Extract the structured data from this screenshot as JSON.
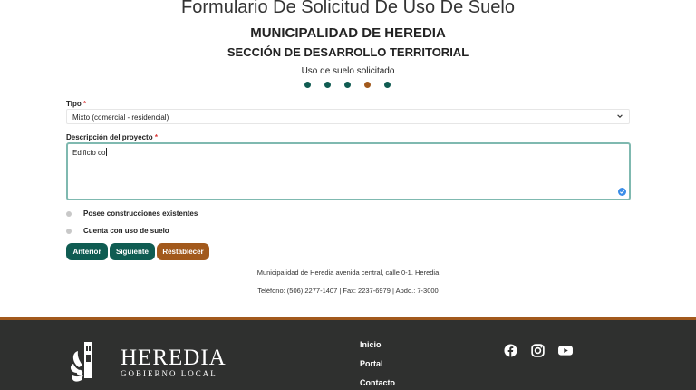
{
  "header": {
    "title": "Formulario De Solicitud De Uso De Suelo",
    "organization": "MUNICIPALIDAD DE HEREDIA",
    "section": "SECCIÓN DE DESARROLLO TERRITORIAL",
    "step_label": "Uso de suelo solicitado"
  },
  "steps": {
    "total": 5,
    "current": 4,
    "colors": {
      "default": "#0f5c52",
      "active": "#a2591c"
    }
  },
  "form": {
    "tipo": {
      "label": "Tipo",
      "required_mark": "*",
      "selected": "Mixto (comercial - residencial)"
    },
    "descripcion": {
      "label": "Descripción del proyecto",
      "required_mark": "*",
      "value": "Edificio co"
    },
    "options": [
      {
        "label": "Posee construcciones existentes"
      },
      {
        "label": "Cuenta con uso de suelo"
      }
    ],
    "buttons": {
      "previous": "Anterior",
      "next": "Siguiente",
      "reset": "Restablecer"
    }
  },
  "contact": {
    "address": "Municipalidad de Heredia avenida central, calle 0-1. Heredia",
    "phones": "Teléfono: (506) 2277-1407 | Fax: 2237-6979 | Apdo.: 7-3000"
  },
  "footer": {
    "brand": "HEREDIA",
    "brand_sub": "GOBIERNO LOCAL",
    "nav": [
      "Inicio",
      "Portal",
      "Contacto"
    ],
    "social_icons": [
      "facebook-icon",
      "instagram-icon",
      "youtube-icon"
    ],
    "colors": {
      "background": "#2f302f",
      "accent": "#a2591c"
    }
  },
  "colors": {
    "primary": "#0f5c52",
    "reset": "#a2591c",
    "focus_border": "#7fb9b0"
  }
}
